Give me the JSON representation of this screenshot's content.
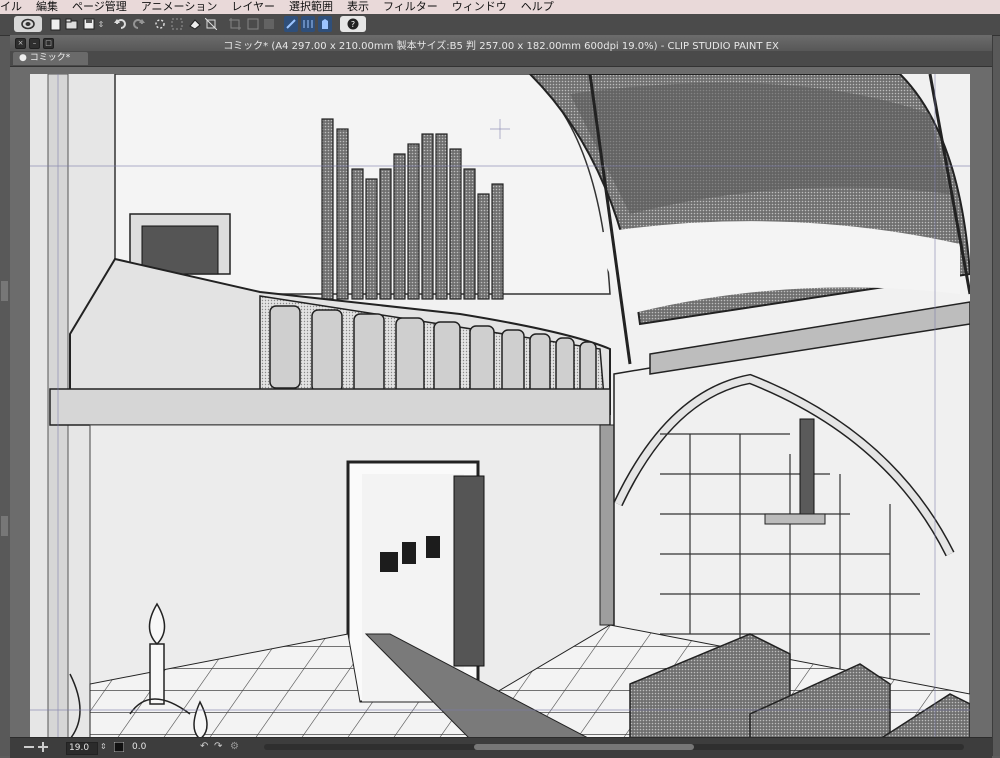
{
  "menu": {
    "items": [
      "イル",
      "編集",
      "ページ管理",
      "アニメーション",
      "レイヤー",
      "選択範囲",
      "表示",
      "フィルター",
      "ウィンドウ",
      "ヘルプ"
    ]
  },
  "toolbar": {
    "icons": [
      "app-logo-icon",
      "new-icon",
      "open-icon",
      "save-icon",
      "undo-icon",
      "redo-icon",
      "transform-icon",
      "fill-icon",
      "snap-ruler-icon",
      "snap-grid-icon",
      "snap-perspective-icon",
      "help-icon"
    ]
  },
  "window": {
    "title": "コミック* (A4 297.00 x 210.00mm 製本サイズ:B5 判 257.00 x 182.00mm 600dpi 19.0%)  - CLIP STUDIO PAINT EX",
    "tab_label": "コミック*"
  },
  "status": {
    "zoom": "19.0",
    "angle": "0.0"
  },
  "colors": {
    "menubar": "#e9d9d9",
    "toolbar": "#4b4b4b",
    "canvas_bg": "#6c6c6c"
  }
}
